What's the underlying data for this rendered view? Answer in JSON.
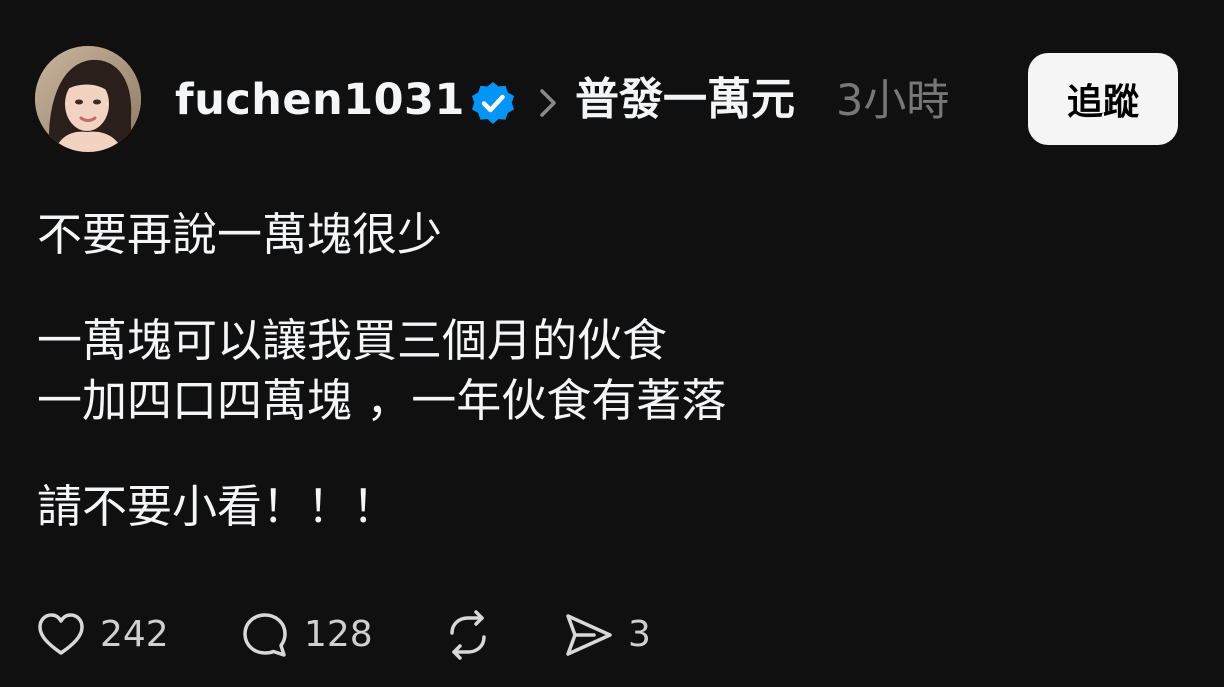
{
  "header": {
    "username": "fuchen1031",
    "topic": "普發一萬元",
    "time": "3小時",
    "follow_label": "追蹤"
  },
  "post": {
    "paragraphs": [
      [
        "不要再說一萬塊很少"
      ],
      [
        "一萬塊可以讓我買三個月的伙食",
        "一加四口四萬塊 ，一年伙食有著落"
      ],
      [
        "請不要小看！！！"
      ]
    ]
  },
  "actions": {
    "likes": "242",
    "comments": "128",
    "shares": "3"
  },
  "icons": {
    "avatar": "profile-photo",
    "verified": "verified-badge-icon",
    "chevron": "chevron-right-icon",
    "like": "heart-icon",
    "comment": "comment-bubble-icon",
    "repost": "repost-icon",
    "share": "send-icon"
  },
  "colors": {
    "background": "#101010",
    "text": "#f3f5f7",
    "muted": "#777777",
    "verified": "#0095f6",
    "button_bg": "#f5f5f5"
  }
}
